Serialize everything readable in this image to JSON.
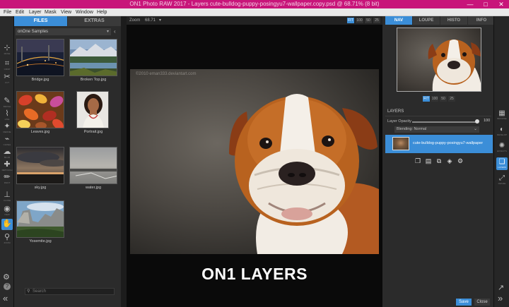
{
  "window": {
    "title": "ON1 Photo RAW 2017 - Layers   cute-bulldog-puppy-posingyu7-wallpaper.copy.psd @ 68.71% (8 bit)",
    "controls": {
      "minimize": "—",
      "maximize": "□",
      "close": "✕"
    }
  },
  "menu": {
    "items": [
      "File",
      "Edit",
      "Layer",
      "Mask",
      "View",
      "Window",
      "Help"
    ]
  },
  "toolbar": {
    "tools": [
      {
        "name": "transform-tool",
        "icon": "transform-icon",
        "glyph": "⊹",
        "label": "MOVE"
      },
      {
        "name": "crop-tool",
        "icon": "crop-icon",
        "glyph": "⌗",
        "label": "CROP"
      },
      {
        "name": "cut-tool",
        "icon": "scissors-icon",
        "glyph": "✂",
        "label": "CUT"
      },
      {
        "name": "brush-tool",
        "icon": "brush-icon",
        "glyph": "✎",
        "label": "BRUSH"
      },
      {
        "name": "line-mask-tool",
        "icon": "line-mask-icon",
        "glyph": "⌇",
        "label": "LINE"
      },
      {
        "name": "refine-tool",
        "icon": "refine-icon",
        "glyph": "✦",
        "label": "REFINE"
      },
      {
        "name": "chisel-tool",
        "icon": "chisel-icon",
        "glyph": "⌁",
        "label": "CHISEL"
      },
      {
        "name": "blur-tool",
        "icon": "blur-icon",
        "glyph": "☁",
        "label": "BLUR"
      },
      {
        "name": "retouch-tool",
        "icon": "retouch-icon",
        "glyph": "✚",
        "label": "RETOUCH"
      },
      {
        "name": "paint-tool",
        "icon": "paint-icon",
        "glyph": "✏",
        "label": "PAINT"
      },
      {
        "name": "clone-tool",
        "icon": "clone-stamp-icon",
        "glyph": "⊥",
        "label": "CLONE"
      },
      {
        "name": "view-tool",
        "icon": "eye-icon",
        "glyph": "◉",
        "label": "VIEW"
      },
      {
        "name": "hand-tool",
        "icon": "hand-icon",
        "glyph": "✋",
        "label": "HAND"
      },
      {
        "name": "zoom-tool",
        "icon": "zoom-icon",
        "glyph": "⚲",
        "label": "ZOOM"
      }
    ],
    "settings_glyph": "⚙",
    "help_glyph": "?",
    "collapse_glyph": "«"
  },
  "browser": {
    "tabs": {
      "files": "FILES",
      "extras": "EXTRAS"
    },
    "source": "onOne Samples",
    "collapse_glyph": "‹",
    "thumbnails": [
      {
        "caption": "Bridge.jpg"
      },
      {
        "caption": "Broken Top.jpg"
      },
      {
        "caption": "Leaves.jpg"
      },
      {
        "caption": "Portrait.jpg"
      },
      {
        "caption": "sky.jpg"
      },
      {
        "caption": "water.jpg"
      },
      {
        "caption": "Yosemite.jpg"
      }
    ],
    "search_placeholder": "Search",
    "search_icon": "search-icon"
  },
  "canvas": {
    "zoom_label": "Zoom",
    "zoom_value": "68.71",
    "zoom_buttons": [
      "FIT",
      "100",
      "50",
      "25"
    ],
    "watermark": "©2010 eman333.deviantart.com",
    "overlay_title": "ON1 LAYERS"
  },
  "panel": {
    "tabs": [
      "NAV",
      "LOUPE",
      "HISTO",
      "INFO"
    ],
    "nav_zoom_buttons": [
      "FIT",
      "100",
      "50",
      "25"
    ],
    "layers_heading": "LAYERS",
    "opacity_label": "Layer Opacity",
    "opacity_value": "100",
    "opacity_fraction": 1.0,
    "blend_mode": "Blending: Normal",
    "layer_name": "cute-bulldog-puppy-posingyu7-wallpaper",
    "layer_tools": [
      {
        "name": "copy-layer-icon",
        "glyph": "❐"
      },
      {
        "name": "new-layer-icon",
        "glyph": "▤"
      },
      {
        "name": "merge-layer-icon",
        "glyph": "⧉"
      },
      {
        "name": "fill-layer-icon",
        "glyph": "◈"
      },
      {
        "name": "layer-settings-icon",
        "glyph": "⚙"
      }
    ]
  },
  "modules": {
    "items": [
      {
        "name": "browse-module",
        "icon": "browse-icon",
        "glyph": "▦",
        "label": "BROWSE"
      },
      {
        "name": "develop-module",
        "icon": "develop-icon",
        "glyph": "◐",
        "label": "DEVELOP"
      },
      {
        "name": "effects-module",
        "icon": "effects-icon",
        "glyph": "✺",
        "label": "EFFECTS"
      },
      {
        "name": "layers-module",
        "icon": "layers-icon",
        "glyph": "❏",
        "label": "LAYERS"
      },
      {
        "name": "resize-module",
        "icon": "resize-icon",
        "glyph": "⤢",
        "label": "RESIZE"
      }
    ],
    "share_glyph": "↗",
    "expand_glyph": "»"
  },
  "footer": {
    "save": "Save",
    "close": "Close"
  }
}
